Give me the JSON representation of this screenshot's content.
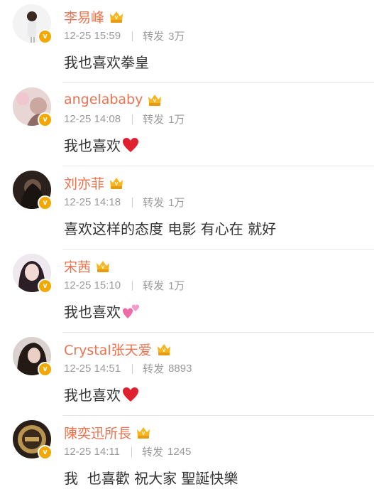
{
  "comments": [
    {
      "name": "李易峰",
      "time": "12-25 15:59",
      "repost_label": "转发",
      "repost_count": "3万",
      "text": "我也喜欢拳皇",
      "emoji": ""
    },
    {
      "name": "angelababy",
      "time": "12-25 14:08",
      "repost_label": "转发",
      "repost_count": "1万",
      "text": "我也喜欢",
      "emoji": "red-heart-icon"
    },
    {
      "name": "刘亦菲",
      "time": "12-25 14:18",
      "repost_label": "转发",
      "repost_count": "1万",
      "text": "喜欢这样的态度 电影 有心在 就好",
      "emoji": ""
    },
    {
      "name": "宋茜",
      "time": "12-25 15:10",
      "repost_label": "转发",
      "repost_count": "1万",
      "text": "我也喜欢",
      "emoji": "pink-hearts-icon"
    },
    {
      "name": "Crystal张天爱",
      "time": "12-25 14:51",
      "repost_label": "转发",
      "repost_count": "8893",
      "text": "我也喜欢",
      "emoji": "red-heart-icon"
    },
    {
      "name": "陳奕迅所長",
      "time": "12-25 14:11",
      "repost_label": "转发",
      "repost_count": "1245",
      "text": "我  也喜歡 祝大家 聖誕快樂",
      "emoji": ""
    }
  ],
  "colors": {
    "name": "#eb7350",
    "meta": "#9a9a9a",
    "text": "#333333",
    "badge": "#f2a800"
  },
  "badge_text": "v"
}
